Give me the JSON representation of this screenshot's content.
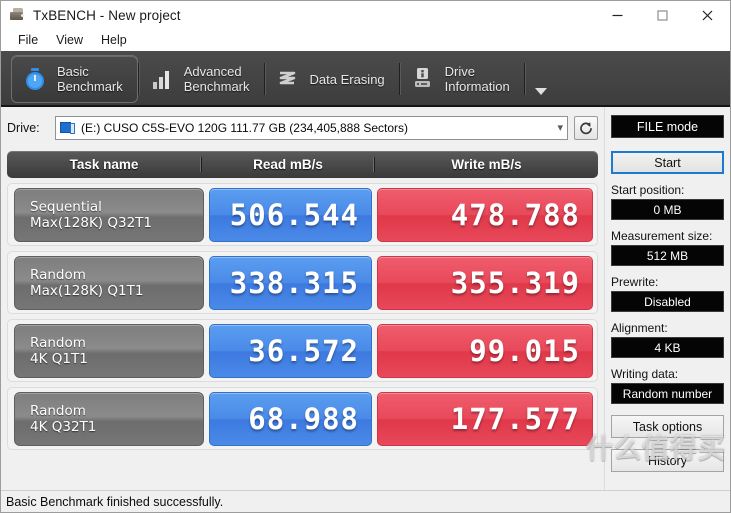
{
  "window": {
    "title": "TxBENCH - New project",
    "icon": "app-icon",
    "controls": {
      "minimize": "–",
      "maximize": "□",
      "close": "✕"
    }
  },
  "menubar": {
    "items": [
      "File",
      "View",
      "Help"
    ]
  },
  "ribbon": {
    "tabs": [
      {
        "label": "Basic\nBenchmark",
        "icon": "stopwatch-icon",
        "active": true
      },
      {
        "label": "Advanced\nBenchmark",
        "icon": "bar-chart-icon",
        "active": false
      },
      {
        "label": "Data Erasing",
        "icon": "eraser-waves-icon",
        "active": false
      },
      {
        "label": "Drive\nInformation",
        "icon": "drive-info-icon",
        "active": false
      }
    ],
    "overflow_icon": "chevron-down-icon"
  },
  "drive": {
    "label": "Drive:",
    "selected": "(E:) CUSO C5S-EVO 120G  111.77 GB (234,405,888 Sectors)",
    "dropdown_icon": "chevron-down-icon",
    "drive_icon": "disk-drive-icon",
    "refresh_icon": "refresh-icon"
  },
  "results": {
    "headers": [
      "Task name",
      "Read mB/s",
      "Write mB/s"
    ],
    "rows": [
      {
        "task_line1": "Sequential",
        "task_line2": "Max(128K) Q32T1",
        "read": "506.544",
        "write": "478.788"
      },
      {
        "task_line1": "Random",
        "task_line2": "Max(128K) Q1T1",
        "read": "338.315",
        "write": "355.319"
      },
      {
        "task_line1": "Random",
        "task_line2": "4K Q1T1",
        "read": "36.572",
        "write": "99.015"
      },
      {
        "task_line1": "Random",
        "task_line2": "4K Q32T1",
        "read": "68.988",
        "write": "177.577"
      }
    ]
  },
  "panel": {
    "mode": "FILE mode",
    "start_label": "Start",
    "fields": [
      {
        "label": "Start position:",
        "value": "0 MB"
      },
      {
        "label": "Measurement size:",
        "value": "512 MB"
      },
      {
        "label": "Prewrite:",
        "value": "Disabled"
      },
      {
        "label": "Alignment:",
        "value": "4 KB"
      },
      {
        "label": "Writing data:",
        "value": "Random number"
      }
    ],
    "buttons": [
      "Task options",
      "History"
    ]
  },
  "statusbar": {
    "text": "Basic Benchmark finished successfully."
  },
  "watermark": {
    "text": "什么值得买"
  },
  "colors": {
    "read_bar": "#4a8ae8",
    "write_bar": "#e8485a",
    "ribbon": "#434343",
    "accent_focus": "#1e7ad1",
    "field_bg": "#050505"
  }
}
